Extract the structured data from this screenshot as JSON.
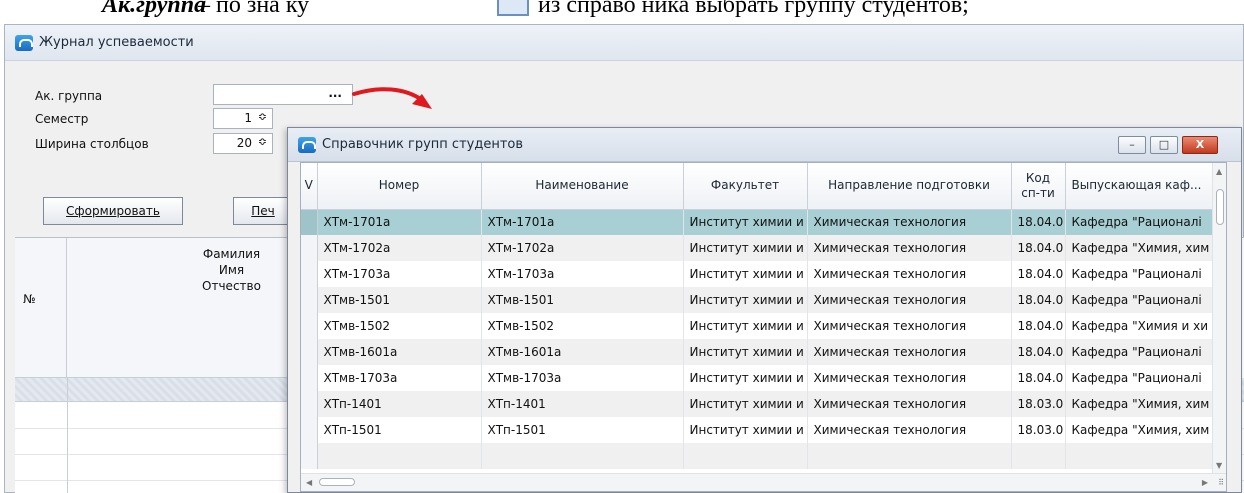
{
  "doc_fragment": {
    "term": "Ак.группа",
    "text_before_icon": "– по зна ку",
    "text_after_icon": "из справо ника выбрать группу студентов;"
  },
  "main_window": {
    "title": "Журнал успеваемости",
    "fields": {
      "group_label": "Ак. группа",
      "group_value": "",
      "picker_dots": "...",
      "semester_label": "Семестр",
      "semester_value": "1",
      "width_label": "Ширина столбцов",
      "width_value": "20",
      "spin_arrows": "≎"
    },
    "buttons": {
      "generate": "Сформировать",
      "print_partial": "Печ"
    },
    "grid": {
      "col_number": "№",
      "col_lastname": "Фамилия",
      "col_firstname": "Имя",
      "col_patronymic": "Отчество"
    }
  },
  "dialog": {
    "title": "Справочник групп студентов",
    "window_buttons": {
      "minimize": "–",
      "maximize": "□",
      "close": "X"
    },
    "columns": [
      "V",
      "Номер",
      "Наименование",
      "Факультет",
      "Направление подготовки",
      "Код сп-ти",
      "Выпускающая каф..."
    ],
    "code_header": [
      "Код",
      "сп-ти"
    ],
    "selected_row_index": 0,
    "rows": [
      {
        "number": "ХТм-1701а",
        "name": "ХТм-1701а",
        "faculty": "Институт химии и",
        "direction": "Химическая технология",
        "code": "18.04.0",
        "department": "Кафедра \"Рационалі"
      },
      {
        "number": "ХТм-1702а",
        "name": "ХТм-1702а",
        "faculty": "Институт химии и",
        "direction": "Химическая технология",
        "code": "18.04.0",
        "department": "Кафедра \"Химия, хим"
      },
      {
        "number": "ХТм-1703а",
        "name": "ХТм-1703а",
        "faculty": "Институт химии и",
        "direction": "Химическая технология",
        "code": "18.04.0",
        "department": "Кафедра \"Рационалі"
      },
      {
        "number": "ХТмв-1501",
        "name": "ХТмв-1501",
        "faculty": "Институт химии и",
        "direction": "Химическая технология",
        "code": "18.04.0",
        "department": "Кафедра \"Рационалі"
      },
      {
        "number": "ХТмв-1502",
        "name": "ХТмв-1502",
        "faculty": "Институт химии и",
        "direction": "Химическая технология",
        "code": "18.04.0",
        "department": "Кафедра \"Химия и хи"
      },
      {
        "number": "ХТмв-1601а",
        "name": "ХТмв-1601а",
        "faculty": "Институт химии и",
        "direction": "Химическая технология",
        "code": "18.04.0",
        "department": "Кафедра \"Рационалі"
      },
      {
        "number": "ХТмв-1703а",
        "name": "ХТмв-1703а",
        "faculty": "Институт химии и",
        "direction": "Химическая технология",
        "code": "18.04.0",
        "department": "Кафедра \"Рационалі"
      },
      {
        "number": "ХТп-1401",
        "name": "ХТп-1401",
        "faculty": "Институт химии и",
        "direction": "Химическая технология",
        "code": "18.03.0",
        "department": "Кафедра \"Химия, хим"
      },
      {
        "number": "ХТп-1501",
        "name": "ХТп-1501",
        "faculty": "Институт химии и",
        "direction": "Химическая технология",
        "code": "18.03.0",
        "department": "Кафедра \"Химия, хим"
      },
      {
        "number": "",
        "name": "",
        "faculty": "",
        "direction": "",
        "code": "",
        "department": ""
      }
    ]
  },
  "colors": {
    "selected_row": "#a8d0d4",
    "arrow_red": "#e0191e",
    "close_button": "#c2391c"
  }
}
